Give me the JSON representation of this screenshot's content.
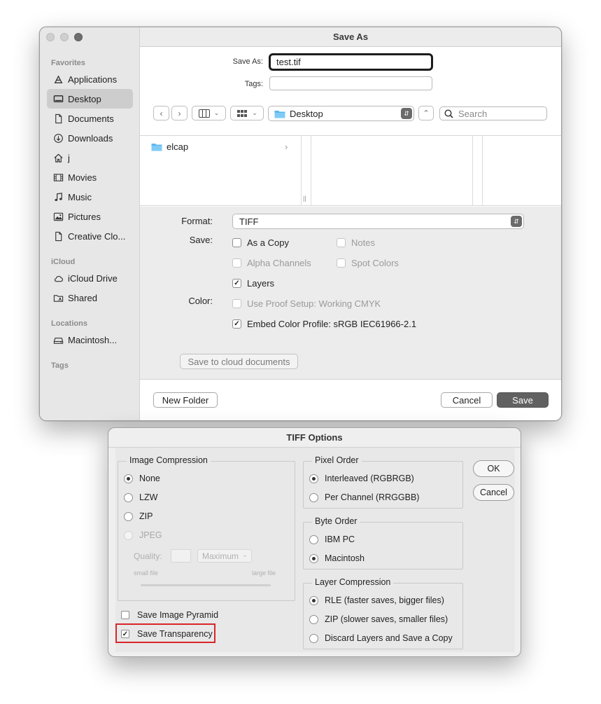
{
  "save_as_window": {
    "title": "Save As",
    "sidebar": {
      "sections": [
        {
          "label": "Favorites"
        },
        {
          "label": "iCloud"
        },
        {
          "label": "Locations"
        },
        {
          "label": "Tags"
        }
      ],
      "favorites": [
        {
          "label": "Applications",
          "icon": "applications-icon"
        },
        {
          "label": "Desktop",
          "icon": "desktop-icon",
          "selected": true
        },
        {
          "label": "Documents",
          "icon": "document-icon"
        },
        {
          "label": "Downloads",
          "icon": "download-icon"
        },
        {
          "label": "j",
          "icon": "home-icon"
        },
        {
          "label": "Movies",
          "icon": "film-icon"
        },
        {
          "label": "Music",
          "icon": "music-note-icon"
        },
        {
          "label": "Pictures",
          "icon": "picture-icon"
        },
        {
          "label": "Creative Clo...",
          "icon": "document-icon"
        }
      ],
      "icloud": [
        {
          "label": "iCloud Drive",
          "icon": "cloud-icon"
        },
        {
          "label": "Shared",
          "icon": "shared-folder-icon"
        }
      ],
      "locations": [
        {
          "label": "Macintosh...",
          "icon": "disk-icon"
        }
      ]
    },
    "save_as_label": "Save As:",
    "save_as_value": "test.tif",
    "tags_label": "Tags:",
    "tags_value": "",
    "location": "Desktop",
    "search_placeholder": "Search",
    "browser_items": [
      {
        "label": "elcap",
        "icon": "folder-icon"
      }
    ],
    "format_label": "Format:",
    "format_value": "TIFF",
    "save_label": "Save:",
    "color_label": "Color:",
    "options": {
      "as_a_copy": {
        "label": "As a Copy",
        "checked": false,
        "enabled": true
      },
      "notes": {
        "label": "Notes",
        "checked": false,
        "enabled": false
      },
      "alpha_channels": {
        "label": "Alpha Channels",
        "checked": false,
        "enabled": false
      },
      "spot_colors": {
        "label": "Spot Colors",
        "checked": false,
        "enabled": false
      },
      "layers": {
        "label": "Layers",
        "checked": true,
        "enabled": true
      },
      "use_proof_setup": {
        "label": "Use Proof Setup:  Working CMYK",
        "checked": false,
        "enabled": false
      },
      "embed_color_profile": {
        "label": "Embed Color Profile:  sRGB IEC61966-2.1",
        "checked": true,
        "enabled": true
      }
    },
    "cloud_button": "Save to cloud documents",
    "new_folder_button": "New Folder",
    "cancel_button": "Cancel",
    "save_button": "Save"
  },
  "tiff_options": {
    "title": "TIFF Options",
    "image_compression": {
      "title": "Image Compression",
      "options": [
        {
          "label": "None",
          "selected": true,
          "enabled": true
        },
        {
          "label": "LZW",
          "selected": false,
          "enabled": true
        },
        {
          "label": "ZIP",
          "selected": false,
          "enabled": true
        },
        {
          "label": "JPEG",
          "selected": false,
          "enabled": false
        }
      ],
      "quality_label": "Quality:",
      "quality_select": "Maximum",
      "small_file": "small file",
      "large_file": "large file"
    },
    "pixel_order": {
      "title": "Pixel Order",
      "options": [
        {
          "label": "Interleaved (RGBRGB)",
          "selected": true
        },
        {
          "label": "Per Channel (RRGGBB)",
          "selected": false
        }
      ]
    },
    "byte_order": {
      "title": "Byte Order",
      "options": [
        {
          "label": "IBM PC",
          "selected": false
        },
        {
          "label": "Macintosh",
          "selected": true
        }
      ]
    },
    "layer_compression": {
      "title": "Layer Compression",
      "options": [
        {
          "label": "RLE (faster saves, bigger files)",
          "selected": true
        },
        {
          "label": "ZIP (slower saves, smaller files)",
          "selected": false
        },
        {
          "label": "Discard Layers and Save a Copy",
          "selected": false
        }
      ]
    },
    "save_image_pyramid": {
      "label": "Save Image Pyramid",
      "checked": false
    },
    "save_transparency": {
      "label": "Save Transparency",
      "checked": true
    },
    "ok_button": "OK",
    "cancel_button": "Cancel",
    "highlight_color": "#d9262b"
  }
}
